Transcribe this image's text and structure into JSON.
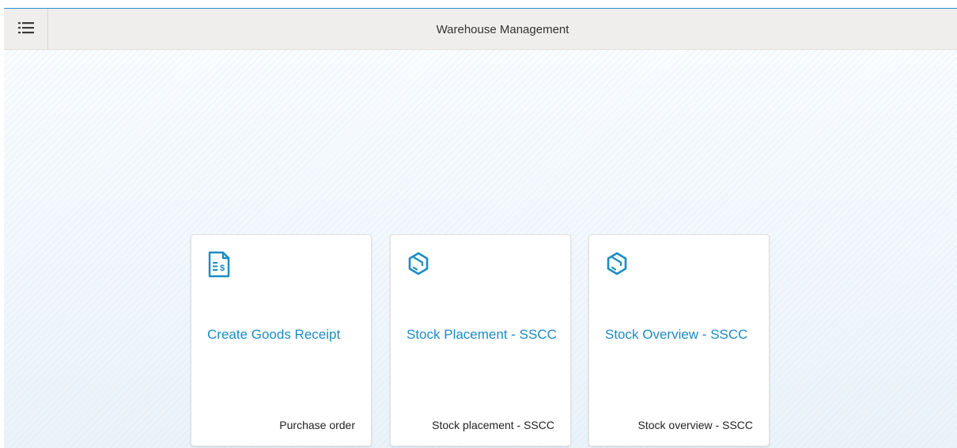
{
  "shell": {
    "title": "Warehouse Management",
    "menu_icon": "list-menu-icon"
  },
  "tiles": [
    {
      "title": "Create Goods Receipt",
      "footer": "Purchase order",
      "icon": "invoice-document-icon"
    },
    {
      "title": "Stock Placement - SSCC",
      "footer": "Stock placement - SSCC",
      "icon": "package-box-icon"
    },
    {
      "title": "Stock Overview - SSCC",
      "footer": "Stock overview - SSCC",
      "icon": "package-box-icon"
    }
  ],
  "colors": {
    "accent": "#1b8bc4",
    "header_bg": "#efeeec",
    "header_border": "#2a8fd1"
  }
}
